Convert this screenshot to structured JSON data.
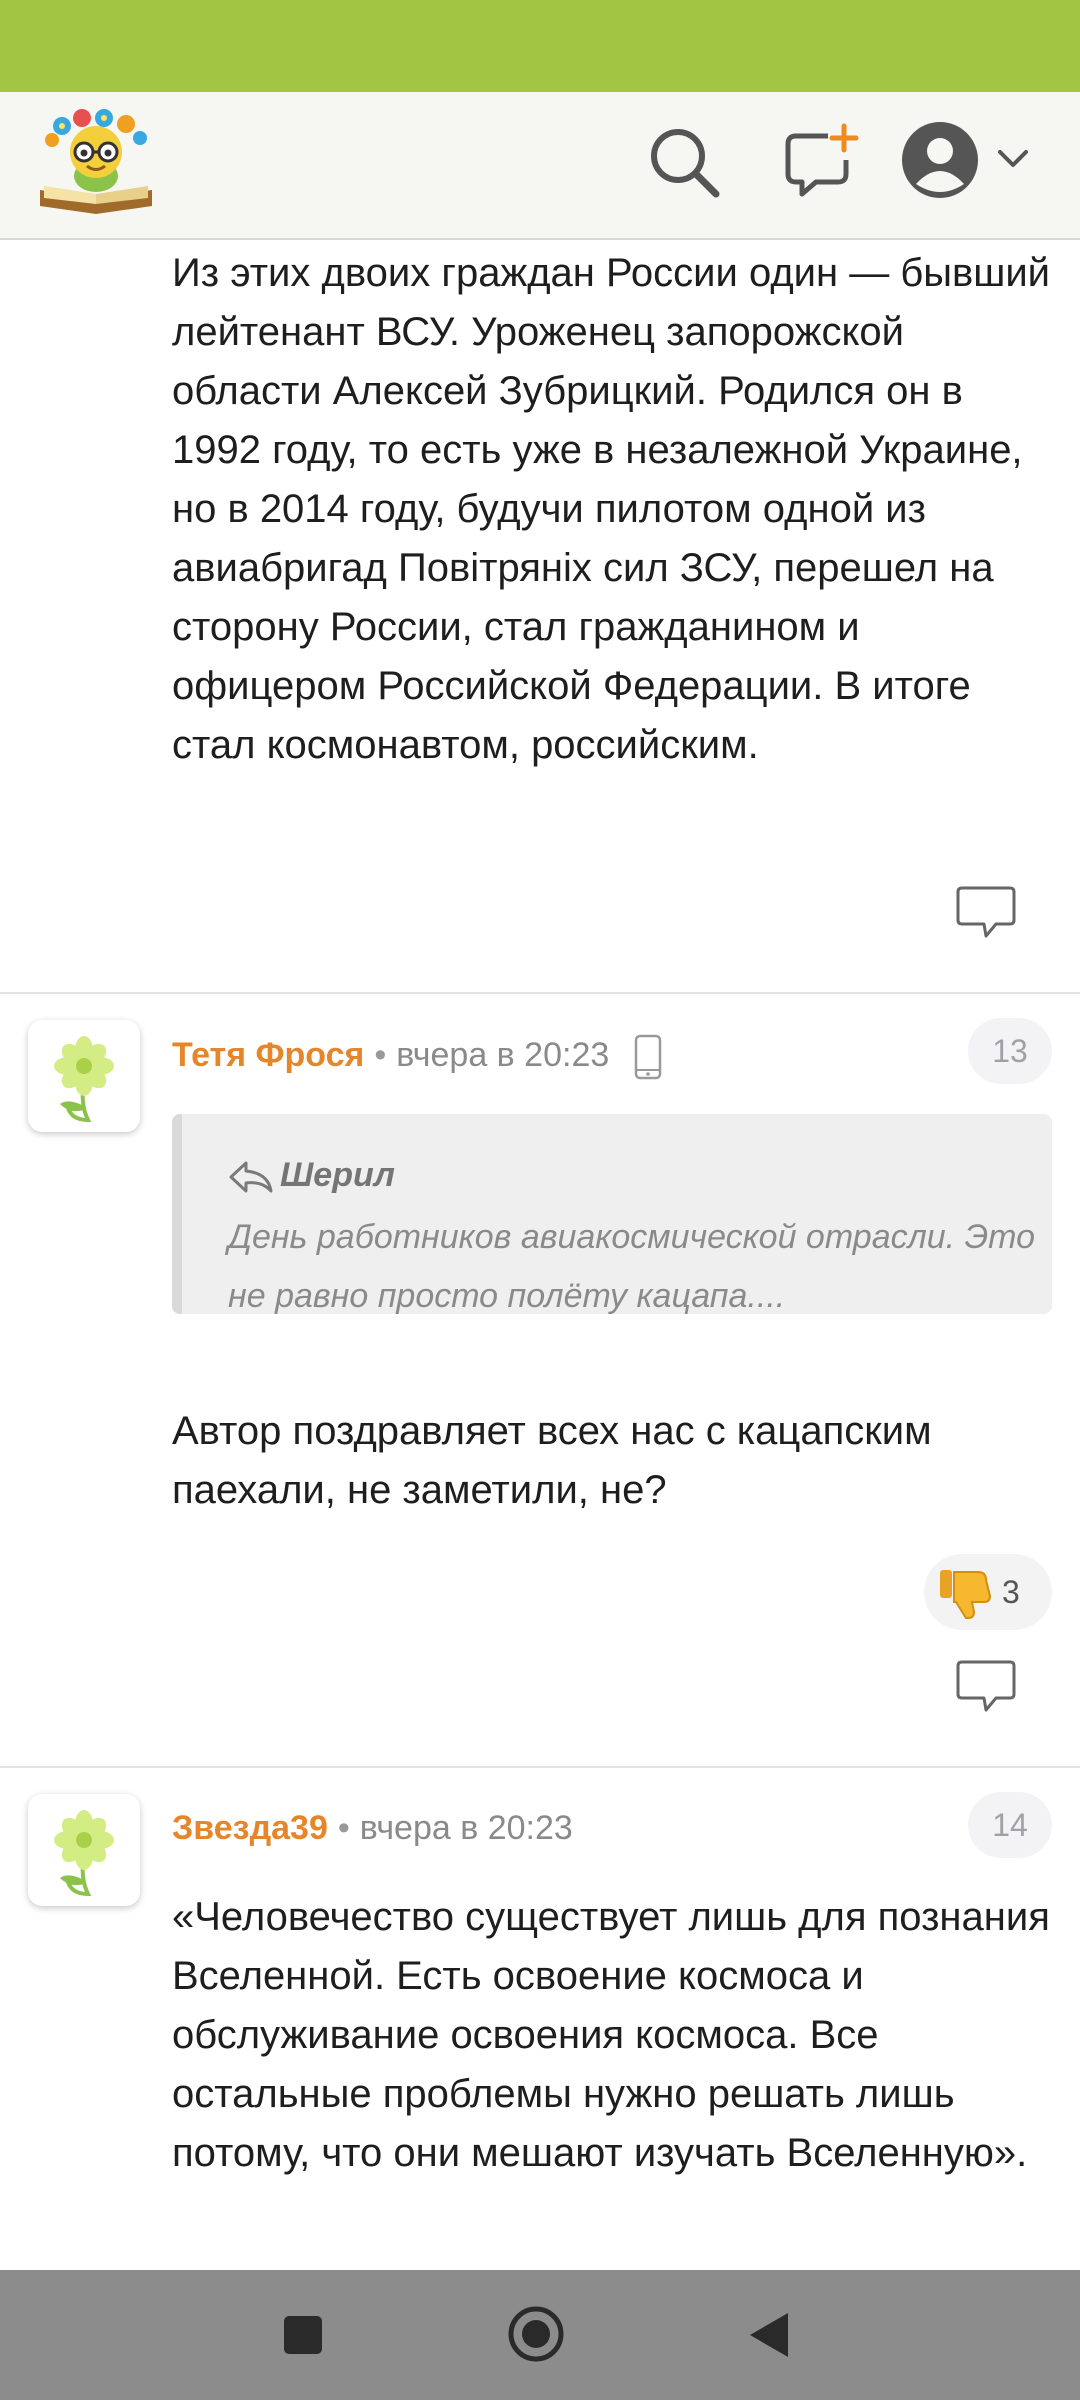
{
  "header": {
    "logo_icon": "book-bee-logo",
    "search_icon": "search-icon",
    "compose_icon": "new-message-icon",
    "profile_icon": "user-avatar-icon"
  },
  "post": {
    "body": "Из этих двоих граждан России один — бывший лейтенант ВСУ. Уроженец запорожской области Алексей Зубрицкий. Родился он в 1992 году, то есть уже в незалежной Украине, но в 2014 году, будучи пилотом одной из авиабригад Повітряніх сил ЗСУ, перешел на сторону России, стал гражданином и офицером Российской Федерации. В итоге стал космонавтом, российским."
  },
  "comments": [
    {
      "author": "Тетя Фрося",
      "separator": "•",
      "time": "вчера в 20:23",
      "device_icon": "phone-icon",
      "number": "13",
      "quote": {
        "author": "Шерил",
        "text": "День работников авиакосмической отрасли. Это не равно просто полёту кацапа...."
      },
      "body": "Автор поздравляет всех нас с кацапским паехали, не заметили, не?",
      "reaction": {
        "icon": "thumbs-down-icon",
        "count": "3"
      }
    },
    {
      "author": "Звезда39",
      "separator": "•",
      "time": "вчера в 20:23",
      "number": "14",
      "body": "«Человечество существует лишь для познания Вселенной. Есть освоение космоса и обслуживание освоения космоса. Все остальные проблемы нужно решать лишь потому, что они мешают изучать Вселенную»."
    }
  ],
  "colors": {
    "status_bar": "#a2c544",
    "author": "#e5862a",
    "nav_bar": "#8c8c8c"
  }
}
